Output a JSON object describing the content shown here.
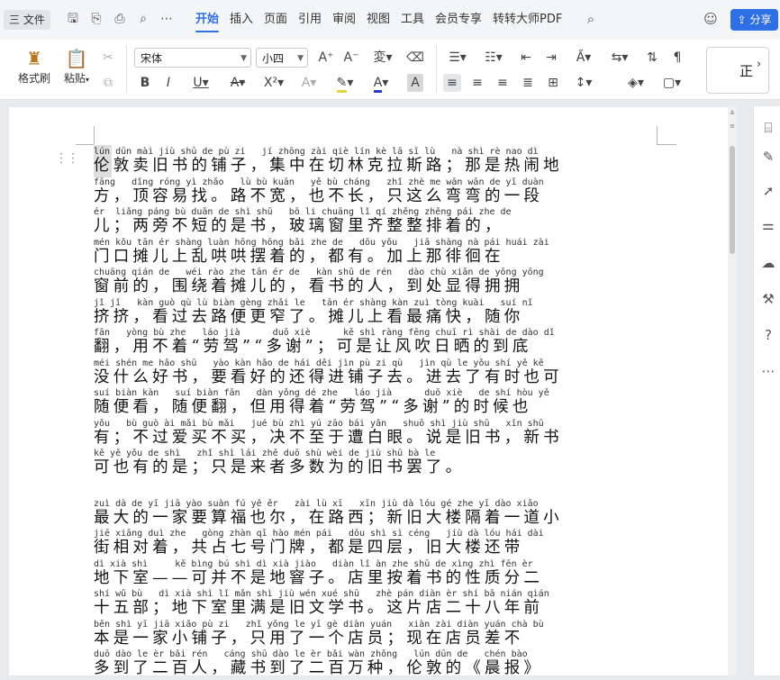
{
  "menubar": {
    "file_label": "三 文件",
    "tabs": [
      {
        "label": "开始",
        "active": true
      },
      {
        "label": "插入"
      },
      {
        "label": "页面"
      },
      {
        "label": "引用"
      },
      {
        "label": "审阅"
      },
      {
        "label": "视图"
      },
      {
        "label": "工具"
      },
      {
        "label": "会员专享"
      },
      {
        "label": "转转大师PDF"
      }
    ],
    "share_label": "分享",
    "accent": "#2e6fe6"
  },
  "toolbar": {
    "format_painter": "格式刷",
    "paste": "粘贴",
    "font_name": "宋体",
    "font_size": "小四",
    "style_preview": "正"
  },
  "document": {
    "lines": [
      {
        "py": "lún dūn mài jiù shū de pù zi   jí zhōng zài qiè lín kè lā sī lù   nà shì rè nao dì",
        "hz": "伦敦卖旧书的铺子，集中在切林克拉斯路；那是热闹地"
      },
      {
        "py": "fāng   dǐng róng yì zhǎo   lù bù kuān   yě bù cháng   zhǐ zhè me wān wān de yī duàn",
        "hz": "方，顶容易找。路不宽，也不长，只这么弯弯的一段"
      },
      {
        "py": "ér  liǎng páng bù duǎn de shì shū   bō li chuāng lǐ qí zhěng zhěng pái zhe de",
        "hz": "儿；两旁不短的是书，玻璃窗里齐整整排着的，"
      },
      {
        "py": "mén kǒu tān ér shàng luàn hōng hōng bǎi zhe de   dōu yǒu   jiā shàng nà pái huái zài",
        "hz": "门口摊儿上乱哄哄摆着的，都有。加上那徘徊在"
      },
      {
        "py": "chuāng qián de   wéi rào zhe tān ér de   kàn shū de rén   dào chù xiǎn de yōng yōng",
        "hz": "窗前的，围绕着摊儿的，看书的人，到处显得拥拥"
      },
      {
        "py": "jǐ jǐ   kàn guò qù lù biàn gèng zhǎi le   tān ér shàng kàn zuì tòng kuài   suí nǐ",
        "hz": "挤挤，看过去路便更窄了。摊儿上看最痛快，随你"
      },
      {
        "py": "fān   yòng bù zhe   láo jià      duō xiè      kě shì ràng fēng chuī rì shài de dào dǐ",
        "hz": "翻，用不着“劳驾”“多谢”；可是让风吹日晒的到底"
      },
      {
        "py": "méi shén me hǎo shū   yào kàn hǎo de hái děi jìn pù zi qù   jìn qù le yǒu shí yě kě",
        "hz": "没什么好书，要看好的还得进铺子去。进去了有时也可"
      },
      {
        "py": "suí biàn kàn   suí biàn fān   dàn yǒng dé zhe   láo jià      duō xiè   de shí hòu yě",
        "hz": "随便看，随便翻，但用得着“劳驾”“多谢”的时候也"
      },
      {
        "py": "yǒu   bù guò ài mǎi bù mǎi   jué bù zhì yú zāo bái yǎn   shuō shì jiù shū   xīn shū",
        "hz": "有；不过爱买不买，决不至于遭白眼。说是旧书，新书"
      },
      {
        "py": "kě yě yǒu de shì   zhǐ shì lái zhě duō shù wèi de jiù shū bà le",
        "hz": "可也有的是；只是来者多数为的旧书罢了。"
      },
      {
        "py": "",
        "hz": ""
      },
      {
        "py": "zuì dà de yī jiā yào suàn fú yě ěr   zài lù xī   xīn jiù dà lóu gé zhe yī dào xiǎo",
        "hz": "最大的一家要算福也尔，在路西；新旧大楼隔着一道小"
      },
      {
        "py": "jiē xiāng duì zhe   gòng zhàn qī hào mén pái   dōu shì sì céng   jiù dà lóu hái dài",
        "hz": "街相对着，共占七号门牌，都是四层，旧大楼还带"
      },
      {
        "py": "dì xià shì     kě bìng bú shì dì xià jiào   diàn lǐ àn zhe shū de xìng zhì fēn èr",
        "hz": "地下室——可并不是地窨子。店里按着书的性质分二"
      },
      {
        "py": "shí wǔ bù   dì xià shì lǐ mǎn shì jiù wén xué shū   zhè pán diàn èr shí bā nián qián",
        "hz": "十五部；地下室里满是旧文学书。这片店二十八年前"
      },
      {
        "py": "běn shì yī jiā xiǎo pù zi   zhǐ yǒng le yī gè diàn yuán   xiàn zài diàn yuán chà bù",
        "hz": "本是一家小铺子，只用了一个店员；现在店员差不"
      },
      {
        "py": "duō dào le èr bǎi rén   cáng shū dào le èr bǎi wàn zhǒng   lún dūn de   chén bào",
        "hz": "多到了二百人，藏书到了二百万种，伦敦的《晨报》"
      }
    ]
  }
}
